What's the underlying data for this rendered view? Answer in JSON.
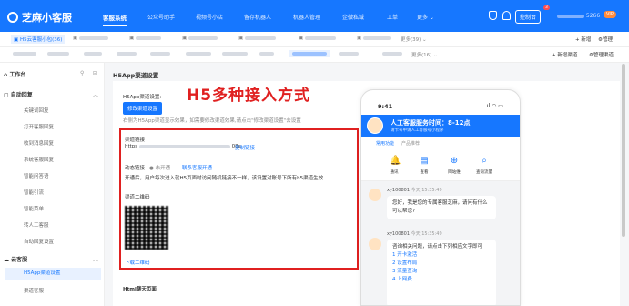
{
  "app": {
    "title": "芝麻小客服"
  },
  "nav": [
    "客服系统",
    "公众号助手",
    "视频号小店",
    "留存机器人",
    "机器人管理",
    "企微私域",
    "工单",
    "更多"
  ],
  "header": {
    "console": "控制台",
    "badge": "3",
    "user_suffix": "5266",
    "vip": "VIP"
  },
  "tabs_row1": {
    "active": "H5云客服小包(36)",
    "more": "更多(39)",
    "add": "+ 新增",
    "manage": "管理"
  },
  "tabs_row2": {
    "more": "更多(16)",
    "add": "+ 新增渠道",
    "manage": "管理渠道"
  },
  "sidebar": {
    "workspace": "工作台",
    "auto_reply_group": "自动回复",
    "auto_items": [
      "关键词回复",
      "打开客服回复",
      "收到消息回复",
      "系统客服回复",
      "智能问答语",
      "智能引流",
      "智能菜单",
      "转人工客服",
      "自动回复设置"
    ],
    "cloud_group": "云客服",
    "cloud_items": [
      "H5App渠道设置",
      "渠道客服"
    ]
  },
  "page": {
    "title": "H5App渠道设置",
    "settings_label": "H5App渠道设置:",
    "modify_button": "修改渠道设置",
    "hint": "右侧为H5App渠道显示效果，如需要修改渠道效果,请点击\"修改渠道设置\"去设置",
    "channel_link_label": "渠道链接",
    "channel_link_prefix": "https",
    "channel_link_suffix": "08e",
    "copy_link": "复制链接",
    "dynamic_link_label": "动态链接",
    "dynamic_status": "未开通",
    "contact_open": "联系客服开通",
    "dynamic_desc": "开通后，用户每次进入就H5页面时访问随机链接不一样，该设置对账号下所有h5渠道生效",
    "qr_label": "渠道二维码",
    "download_qr": "下载二维码",
    "html_section": "Html聊天页面"
  },
  "overlay": {
    "headline": "H5多种接入方式"
  },
  "phone": {
    "time": "9:41",
    "banner_title": "人工客服服务时间：8-12点",
    "banner_sub": "请卡号申请人工客服号小程序",
    "tab_active": "常用功能",
    "tab_other": "产品推荐",
    "features": [
      "通讯",
      "查看",
      "网站维",
      "查询流量"
    ],
    "messages": [
      {
        "sender": "xy100801",
        "time": "今天 15:35:49",
        "text": "您好，我是您的专属客服芝麻，请问有什么可以帮您?"
      },
      {
        "sender": "xy100801",
        "time": "今天 15:35:49",
        "text": "咨询相关问题，请点击下列相应文字即可",
        "items": [
          "1 开卡激活",
          "2 设置布局",
          "3 流量查询",
          "4 上网费"
        ]
      }
    ]
  }
}
